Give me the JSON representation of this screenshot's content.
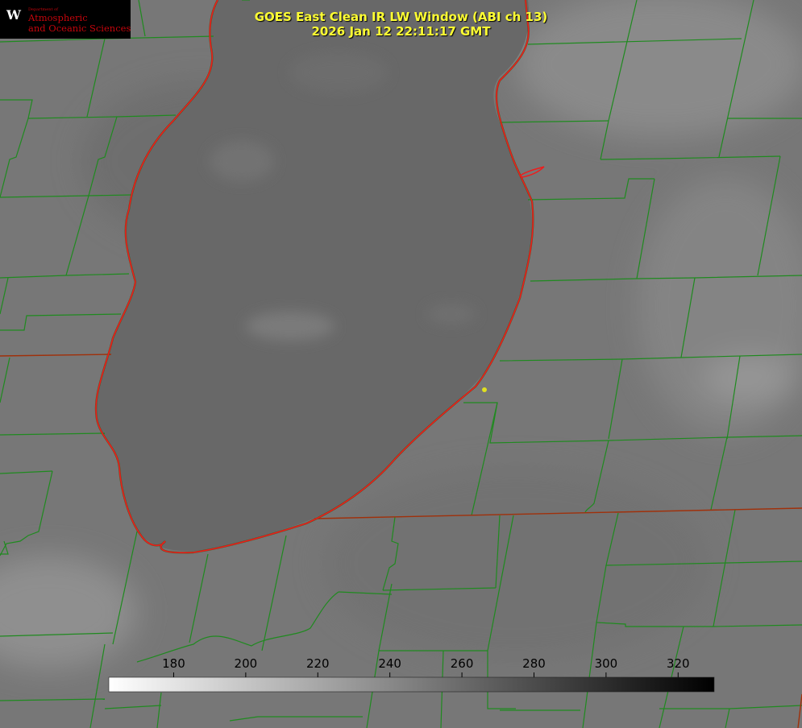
{
  "logo": {
    "department": "Department of",
    "name_line1": "Atmospheric",
    "name_line2": "and Oceanic Sciences",
    "crest_letter": "W",
    "crest_color": "#c5050c"
  },
  "title": {
    "line1": "GOES East Clean IR LW Window (ABI ch 13)",
    "line2": "2026 Jan 12 22:11:17 GMT",
    "color": "#ffff33"
  },
  "colorbar": {
    "ticks": [
      180,
      200,
      220,
      240,
      260,
      280,
      300,
      320
    ],
    "range": [
      162,
      330
    ],
    "scale": "white-to-black"
  },
  "colors": {
    "lake_shoreline": "#ee1c1c",
    "county_lines": "#1f8a1f",
    "state_lines": "#a0300a",
    "marker": "#e0e020"
  }
}
